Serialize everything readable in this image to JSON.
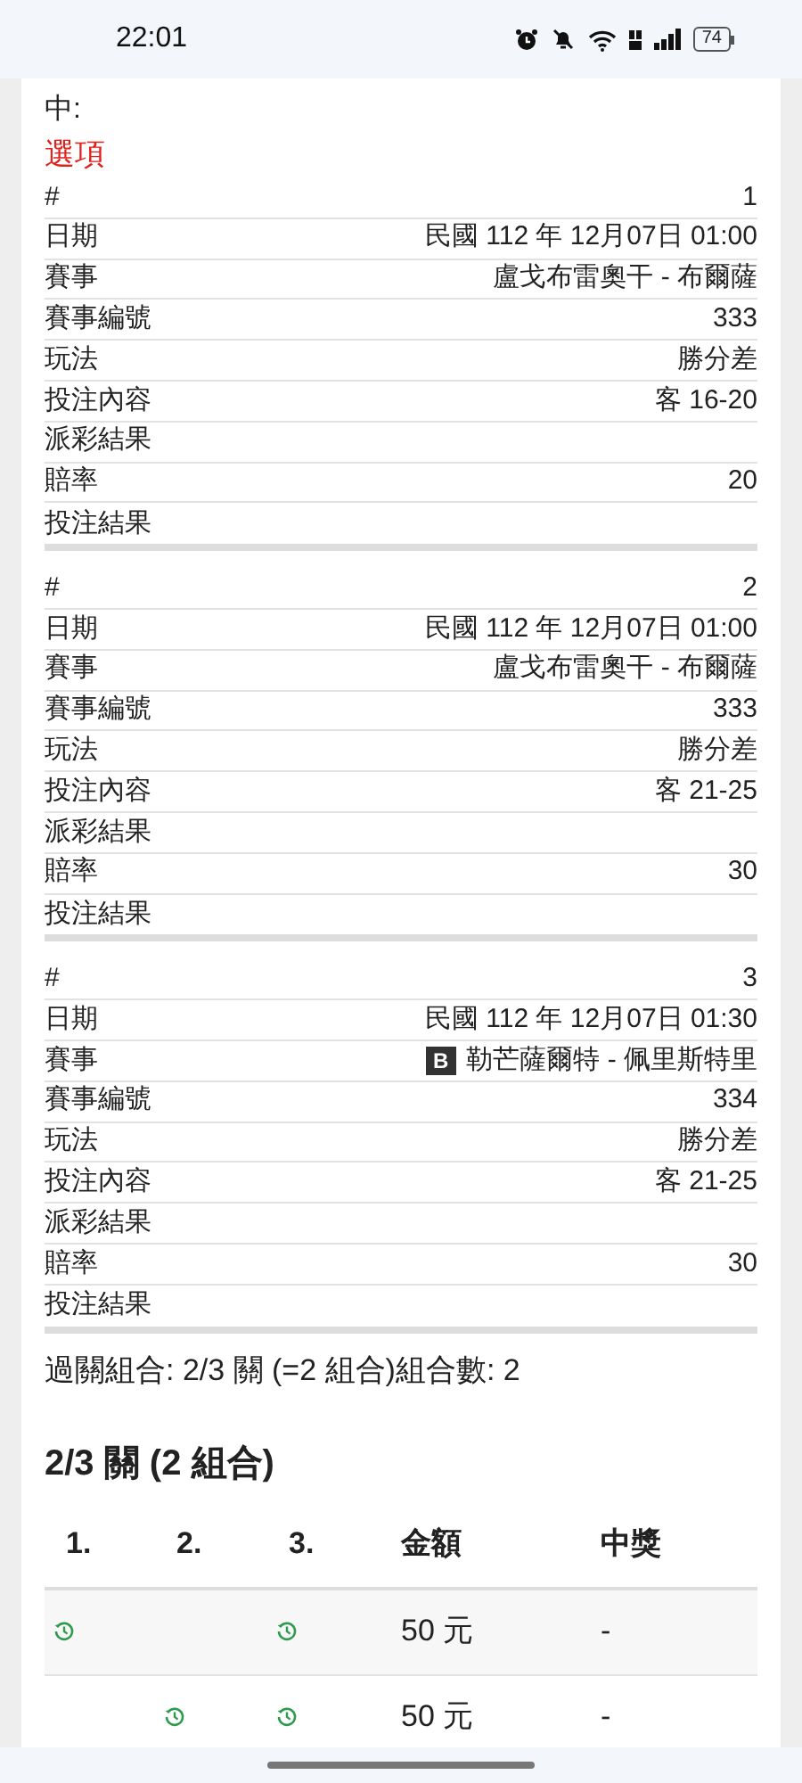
{
  "status_bar": {
    "time": "22:01",
    "battery": "74"
  },
  "intro": "中:",
  "options_heading": "選項",
  "bets": [
    {
      "rows": [
        {
          "label": "#",
          "value": "1"
        },
        {
          "label": "日期",
          "value": "民國 112 年 12月07日 01:00"
        },
        {
          "label": "賽事",
          "value": "盧戈布雷奧干 - 布爾薩"
        },
        {
          "label": "賽事編號",
          "value": "333"
        },
        {
          "label": "玩法",
          "value": "勝分差"
        },
        {
          "label": "投注內容",
          "value": "客 16-20"
        },
        {
          "label": "派彩結果"
        },
        {
          "label": "賠率",
          "value": "20"
        },
        {
          "label": "投注結果"
        }
      ]
    },
    {
      "rows": [
        {
          "label": "#",
          "value": "2"
        },
        {
          "label": "日期",
          "value": "民國 112 年 12月07日 01:00"
        },
        {
          "label": "賽事",
          "value": "盧戈布雷奧干 - 布爾薩"
        },
        {
          "label": "賽事編號",
          "value": "333"
        },
        {
          "label": "玩法",
          "value": "勝分差"
        },
        {
          "label": "投注內容",
          "value": "客 21-25"
        },
        {
          "label": "派彩結果"
        },
        {
          "label": "賠率",
          "value": "30"
        },
        {
          "label": "投注結果"
        }
      ]
    },
    {
      "rows": [
        {
          "label": "#",
          "value": "3"
        },
        {
          "label": "日期",
          "value": "民國 112 年 12月07日 01:30"
        },
        {
          "label": "賽事",
          "value": "勒芒薩爾特 - 佩里斯特里",
          "badge": "B"
        },
        {
          "label": "賽事編號",
          "value": "334"
        },
        {
          "label": "玩法",
          "value": "勝分差"
        },
        {
          "label": "投注內容",
          "value": "客 21-25"
        },
        {
          "label": "派彩結果"
        },
        {
          "label": "賠率",
          "value": "30"
        },
        {
          "label": "投注結果"
        }
      ]
    }
  ],
  "parlay_summary": "過關組合: 2/3 關 (=2 組合)組合數: 2",
  "combo": {
    "title": "2/3 關 (2 組合)",
    "columns": [
      "1.",
      "2.",
      "3.",
      "金額",
      "中獎"
    ],
    "rows": [
      {
        "legs": [
          true,
          false,
          true
        ],
        "amount": "50 元",
        "prize": "-"
      },
      {
        "legs": [
          false,
          true,
          true
        ],
        "amount": "50 元",
        "prize": "-"
      }
    ]
  }
}
